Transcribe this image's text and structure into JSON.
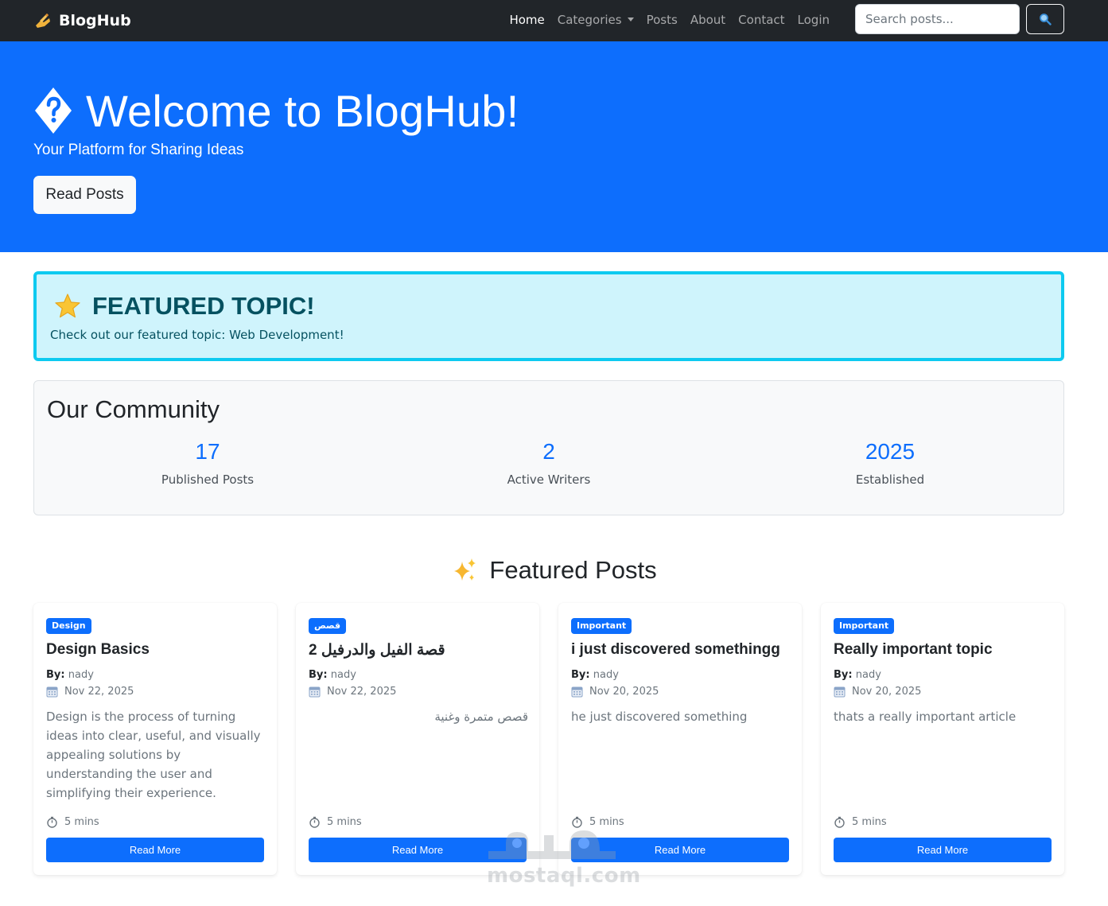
{
  "navbar": {
    "brand": "BlogHub",
    "links": {
      "home": "Home",
      "categories": "Categories",
      "posts": "Posts",
      "about": "About",
      "contact": "Contact",
      "login": "Login"
    },
    "search_placeholder": "Search posts..."
  },
  "hero": {
    "title": "Welcome to BlogHub!",
    "subtitle": "Your Platform for Sharing Ideas",
    "button": "Read Posts"
  },
  "featured_topic": {
    "title": "FEATURED TOPIC!",
    "text": "Check out our featured topic: Web Development!"
  },
  "community": {
    "title": "Our Community",
    "stats": [
      {
        "value": "17",
        "label": "Published Posts"
      },
      {
        "value": "2",
        "label": "Active Writers"
      },
      {
        "value": "2025",
        "label": "Established"
      }
    ]
  },
  "featured_posts": {
    "heading": "Featured Posts",
    "posts": [
      {
        "category": "Design",
        "title": "Design Basics",
        "by_label": "By:",
        "author": "nady",
        "date": "Nov 22, 2025",
        "excerpt": "Design is the process of turning ideas into clear, useful, and visually appealing solutions by understanding the user and simplifying their experience.",
        "read_time": "5 mins",
        "button": "Read More"
      },
      {
        "category": "قصص",
        "title": "قصة الفيل والدرفيل 2",
        "by_label": "By:",
        "author": "nady",
        "date": "Nov 22, 2025",
        "excerpt": "قصص متمرة وغنية",
        "read_time": "5 mins",
        "button": "Read More"
      },
      {
        "category": "Important",
        "title": "i just discovered somethingg",
        "by_label": "By:",
        "author": "nady",
        "date": "Nov 20, 2025",
        "excerpt": "he just discovered something",
        "read_time": "5 mins",
        "button": "Read More"
      },
      {
        "category": "Important",
        "title": "Really important topic",
        "by_label": "By:",
        "author": "nady",
        "date": "Nov 20, 2025",
        "excerpt": "thats a really important article",
        "read_time": "5 mins",
        "button": "Read More"
      }
    ]
  },
  "watermark": "mostaql.com",
  "colors": {
    "navbar_bg": "#212529",
    "primary": "#0d6efd",
    "info_bg": "#cff4fc",
    "info_border": "#0dcaf0",
    "info_text": "#055160"
  },
  "icons": {
    "brand": "writing-hand-icon",
    "hero": "question-diamond-icon",
    "topic": "star-icon",
    "posts": "sparkles-icon",
    "date": "calendar-icon",
    "time": "stopwatch-icon",
    "search": "magnifier-icon"
  }
}
